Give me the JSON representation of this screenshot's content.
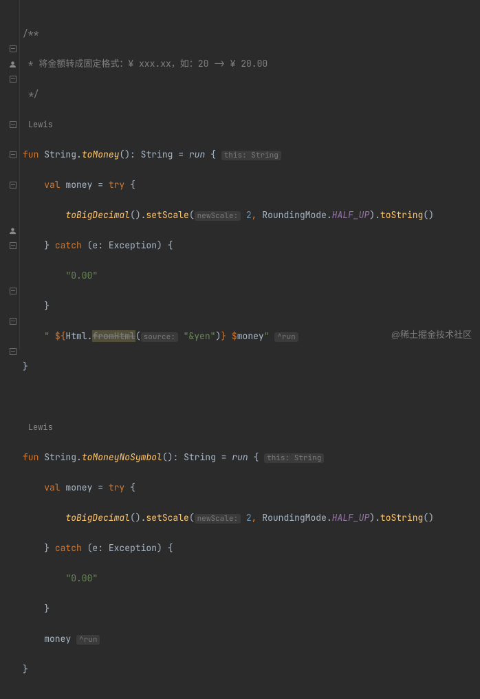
{
  "comment": {
    "open": "/**",
    "body": " * 将金额转成固定格式：¥ xxx.xx，如：20 -> ¥ 20.00",
    "close": " */"
  },
  "author1": "Lewis",
  "fn1": {
    "kw_fun": "fun",
    "recv": "String",
    "dot1": ".",
    "name": "toMoney",
    "sig_post": "(): ",
    "ret_type": "String",
    "eq": " = ",
    "run": "run",
    "brace_open": " { ",
    "hint_this": "this: String",
    "val": "val",
    "money": " money ",
    "assign": "= ",
    "try": "try",
    "brace2": " {",
    "toBigDecimal": "toBigDecimal",
    "call1": "().",
    "setScale": "setScale",
    "lp": "(",
    "hint_newScale": "newScale:",
    "two": " 2",
    "comma": ", ",
    "rmode": "RoundingMode.",
    "halfup": "HALF_UP",
    "rp_chain": ").",
    "toString": "toString",
    "tail": "()",
    "brace_close1": "}",
    "catch": " catch ",
    "catch_paren": "(e: Exception) {",
    "zero": "\"0.00\"",
    "brace_close2": "}",
    "str_open": "\" ",
    "tmpl_open": "${",
    "html": "Html.",
    "fromHtml": "fromHtml",
    "lp2": "(",
    "hint_source": "source:",
    "yen": " \"&yen\"",
    "rp2": ")",
    "tmpl_close": "}",
    "sp": " ",
    "dollar": "$",
    "money_ref": "money",
    "str_close": "\"",
    "hint_run": "^run",
    "brace_close3": "}"
  },
  "author2": "Lewis",
  "fn2": {
    "kw_fun": "fun",
    "recv": "String",
    "dot1": ".",
    "name": "toMoneyNoSymbol",
    "sig_post": "(): ",
    "ret_type": "String",
    "eq": " = ",
    "run": "run",
    "brace_open": " { ",
    "hint_this": "this: String",
    "val": "val",
    "money": " money ",
    "assign": "= ",
    "try": "try",
    "brace2": " {",
    "toBigDecimal": "toBigDecimal",
    "call1": "().",
    "setScale": "setScale",
    "lp": "(",
    "hint_newScale": "newScale:",
    "two": " 2",
    "comma": ", ",
    "rmode": "RoundingMode.",
    "halfup": "HALF_UP",
    "rp_chain": ").",
    "toString": "toString",
    "tail": "()",
    "brace_close1": "}",
    "catch": " catch ",
    "catch_paren": "(e: Exception) {",
    "zero": "\"0.00\"",
    "brace_close2": "}",
    "money_line": "money",
    "hint_run": "^run",
    "brace_close3": "}"
  },
  "watermark": "@稀土掘金技术社区"
}
